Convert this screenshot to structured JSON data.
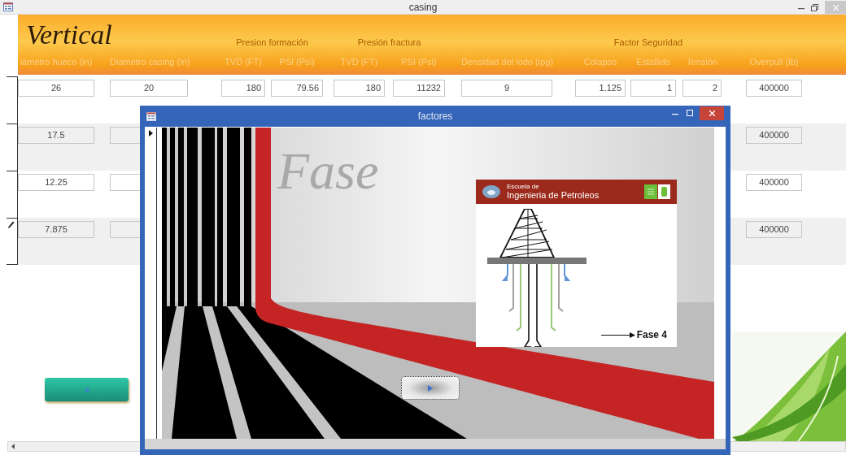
{
  "window": {
    "title": "casing"
  },
  "header": {
    "title": "Vertical",
    "groups": [
      "Presion formación",
      "Presión fractura",
      "Factor Seguridad"
    ],
    "columns": [
      "iámetro hueco (in)",
      "Diametro casing (in)",
      "TVD (FT)",
      "PSI (Psi)",
      "TVD (FT)",
      "PSI (Psi)",
      "Densidad del lodo (ipg)",
      "Colapso",
      "Estallido",
      "Tensión",
      "Overpull (lb)"
    ]
  },
  "rows": [
    {
      "diametro_hueco": "26",
      "middle": [
        "20",
        "180",
        "79.56",
        "180",
        "11232",
        "9",
        "1.125",
        "1",
        "2"
      ],
      "overpull": "400000",
      "editing": false
    },
    {
      "diametro_hueco": "17.5",
      "overpull": "400000",
      "editing": false
    },
    {
      "diametro_hueco": "12.25",
      "overpull": "400000",
      "editing": false
    },
    {
      "diametro_hueco": "7.875",
      "overpull": "400000",
      "editing": true
    }
  ],
  "dialog": {
    "title": "factores",
    "slide": {
      "heading": "Fase",
      "inset": {
        "school_small": "Escuela de",
        "school": "Ingenieria de Petroleos",
        "caption": "Fase 4"
      }
    }
  }
}
